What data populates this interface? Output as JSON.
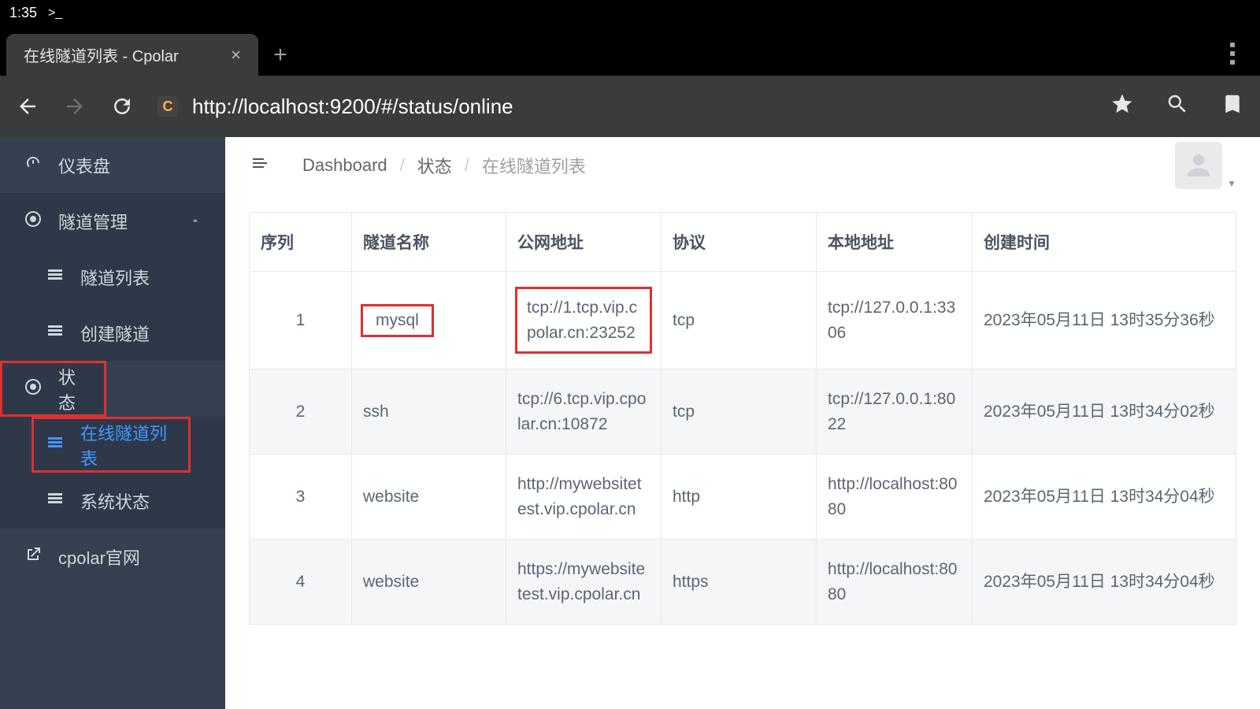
{
  "os": {
    "clock": "1:35",
    "terminal_glyph": ">_"
  },
  "browser": {
    "tab_title": "在线隧道列表 - Cpolar",
    "site_letter": "C",
    "url": "http://localhost:9200/#/status/online"
  },
  "sidebar": {
    "dashboard": "仪表盘",
    "tunnel_mgmt": "隧道管理",
    "tunnel_list": "隧道列表",
    "create_tunnel": "创建隧道",
    "status": "状态",
    "online_list": "在线隧道列表",
    "system_status": "系统状态",
    "cpolar_site": "cpolar官网"
  },
  "breadcrumb": {
    "a": "Dashboard",
    "b": "状态",
    "c": "在线隧道列表"
  },
  "table": {
    "headers": {
      "seq": "序列",
      "name": "隧道名称",
      "public": "公网地址",
      "proto": "协议",
      "local": "本地地址",
      "created": "创建时间"
    },
    "rows": [
      {
        "seq": "1",
        "name": "mysql",
        "public": "tcp://1.tcp.vip.cpolar.cn:23252",
        "proto": "tcp",
        "local": "tcp://127.0.0.1:3306",
        "created": "2023年05月11日 13时35分36秒"
      },
      {
        "seq": "2",
        "name": "ssh",
        "public": "tcp://6.tcp.vip.cpolar.cn:10872",
        "proto": "tcp",
        "local": "tcp://127.0.0.1:8022",
        "created": "2023年05月11日 13时34分02秒"
      },
      {
        "seq": "3",
        "name": "website",
        "public": "http://mywebsitetest.vip.cpolar.cn",
        "proto": "http",
        "local": "http://localhost:8080",
        "created": "2023年05月11日 13时34分04秒"
      },
      {
        "seq": "4",
        "name": "website",
        "public": "https://mywebsitetest.vip.cpolar.cn",
        "proto": "https",
        "local": "http://localhost:8080",
        "created": "2023年05月11日 13时34分04秒"
      }
    ]
  }
}
